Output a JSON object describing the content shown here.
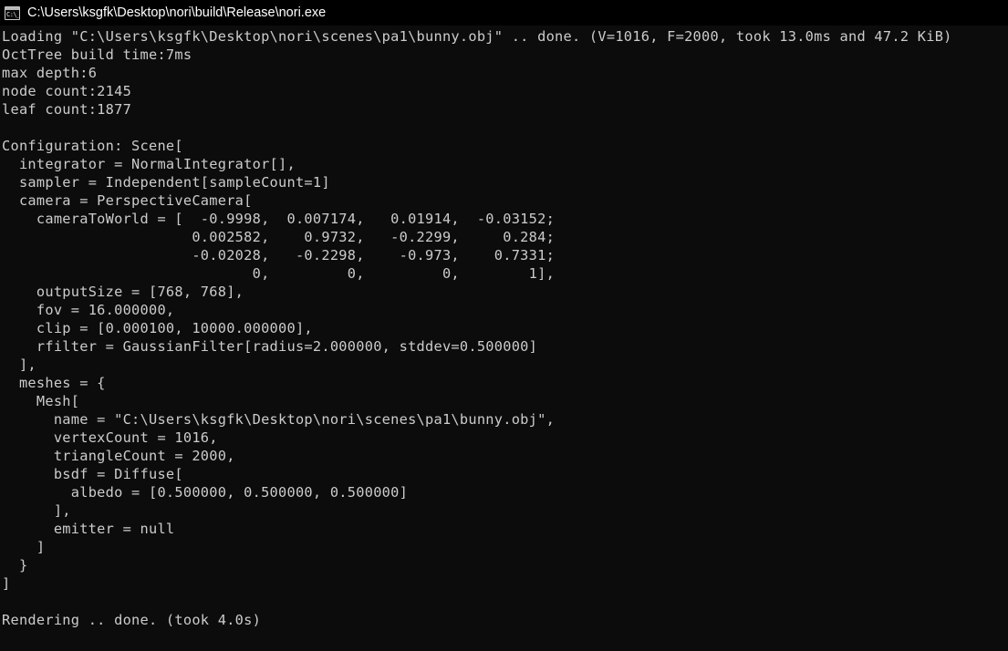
{
  "window": {
    "title": "C:\\Users\\ksgfk\\Desktop\\nori\\build\\Release\\nori.exe",
    "icon": "console-icon",
    "icon_prompt": "C:\\_",
    "background_color": "#0c0c0c",
    "titlebar_color": "#000000",
    "text_color": "#cccccc",
    "title_color": "#ffffff"
  },
  "console": {
    "lines": [
      "Loading \"C:\\Users\\ksgfk\\Desktop\\nori\\scenes\\pa1\\bunny.obj\" .. done. (V=1016, F=2000, took 13.0ms and 47.2 KiB)",
      "OctTree build time:7ms",
      "max depth:6",
      "node count:2145",
      "leaf count:1877",
      "",
      "Configuration: Scene[",
      "  integrator = NormalIntegrator[],",
      "  sampler = Independent[sampleCount=1]",
      "  camera = PerspectiveCamera[",
      "    cameraToWorld = [  -0.9998,  0.007174,   0.01914,  -0.03152;",
      "                      0.002582,    0.9732,   -0.2299,     0.284;",
      "                      -0.02028,   -0.2298,    -0.973,    0.7331;",
      "                             0,         0,         0,        1],",
      "    outputSize = [768, 768],",
      "    fov = 16.000000,",
      "    clip = [0.000100, 10000.000000],",
      "    rfilter = GaussianFilter[radius=2.000000, stddev=0.500000]",
      "  ],",
      "  meshes = {",
      "    Mesh[",
      "      name = \"C:\\Users\\ksgfk\\Desktop\\nori\\scenes\\pa1\\bunny.obj\",",
      "      vertexCount = 1016,",
      "      triangleCount = 2000,",
      "      bsdf = Diffuse[",
      "        albedo = [0.500000, 0.500000, 0.500000]",
      "      ],",
      "      emitter = null",
      "    ]",
      "  }",
      "]",
      "",
      "Rendering .. done. (took 4.0s)"
    ]
  },
  "loading": {
    "file": "C:\\Users\\ksgfk\\Desktop\\nori\\scenes\\pa1\\bunny.obj",
    "status": "done.",
    "vertex_count": 1016,
    "face_count": 2000,
    "load_time": "13.0ms",
    "memory": "47.2 KiB"
  },
  "octree": {
    "build_time": "7ms",
    "max_depth": 6,
    "node_count": 2145,
    "leaf_count": 1877
  },
  "scene": {
    "integrator": "NormalIntegrator[]",
    "sampler": "Independent[sampleCount=1]",
    "camera": {
      "type": "PerspectiveCamera",
      "cameraToWorld": [
        [
          -0.9998,
          0.007174,
          0.01914,
          -0.03152
        ],
        [
          0.002582,
          0.9732,
          -0.2299,
          0.284
        ],
        [
          -0.02028,
          -0.2298,
          -0.973,
          0.7331
        ],
        [
          0,
          0,
          0,
          1
        ]
      ],
      "outputSize": [
        768,
        768
      ],
      "fov": "16.000000",
      "clip": [
        "0.000100",
        "10000.000000"
      ],
      "rfilter": "GaussianFilter[radius=2.000000, stddev=0.500000]"
    },
    "mesh": {
      "name": "C:\\Users\\ksgfk\\Desktop\\nori\\scenes\\pa1\\bunny.obj",
      "vertexCount": 1016,
      "triangleCount": 2000,
      "bsdf": "Diffuse",
      "albedo": [
        "0.500000",
        "0.500000",
        "0.500000"
      ],
      "emitter": "null"
    }
  },
  "render": {
    "status": "done.",
    "took": "4.0s"
  }
}
